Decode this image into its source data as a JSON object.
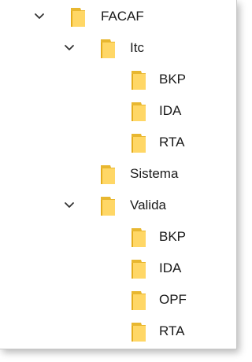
{
  "tree": {
    "nodes": [
      {
        "id": "facaf",
        "label": "FACAF",
        "depth": 0,
        "expandable": true,
        "expanded": true
      },
      {
        "id": "itc",
        "label": "Itc",
        "depth": 1,
        "expandable": true,
        "expanded": true
      },
      {
        "id": "itc-bkp",
        "label": "BKP",
        "depth": 2,
        "expandable": false,
        "expanded": false
      },
      {
        "id": "itc-ida",
        "label": "IDA",
        "depth": 2,
        "expandable": false,
        "expanded": false
      },
      {
        "id": "itc-rta",
        "label": "RTA",
        "depth": 2,
        "expandable": false,
        "expanded": false
      },
      {
        "id": "sistema",
        "label": "Sistema",
        "depth": 1,
        "expandable": false,
        "expanded": false
      },
      {
        "id": "valida",
        "label": "Valida",
        "depth": 1,
        "expandable": true,
        "expanded": true
      },
      {
        "id": "val-bkp",
        "label": "BKP",
        "depth": 2,
        "expandable": false,
        "expanded": false
      },
      {
        "id": "val-ida",
        "label": "IDA",
        "depth": 2,
        "expandable": false,
        "expanded": false
      },
      {
        "id": "val-opf",
        "label": "OPF",
        "depth": 2,
        "expandable": false,
        "expanded": false
      },
      {
        "id": "val-rta",
        "label": "RTA",
        "depth": 2,
        "expandable": false,
        "expanded": false
      }
    ],
    "icons": {
      "expanded_chevron": "chevron-down-icon",
      "folder": "folder-icon"
    }
  },
  "colors": {
    "folder_front": "#ffd766",
    "folder_back": "#e8b730",
    "folder_tab": "#e5ad1d",
    "chevron": "#333333",
    "text": "#1a1a1a"
  }
}
